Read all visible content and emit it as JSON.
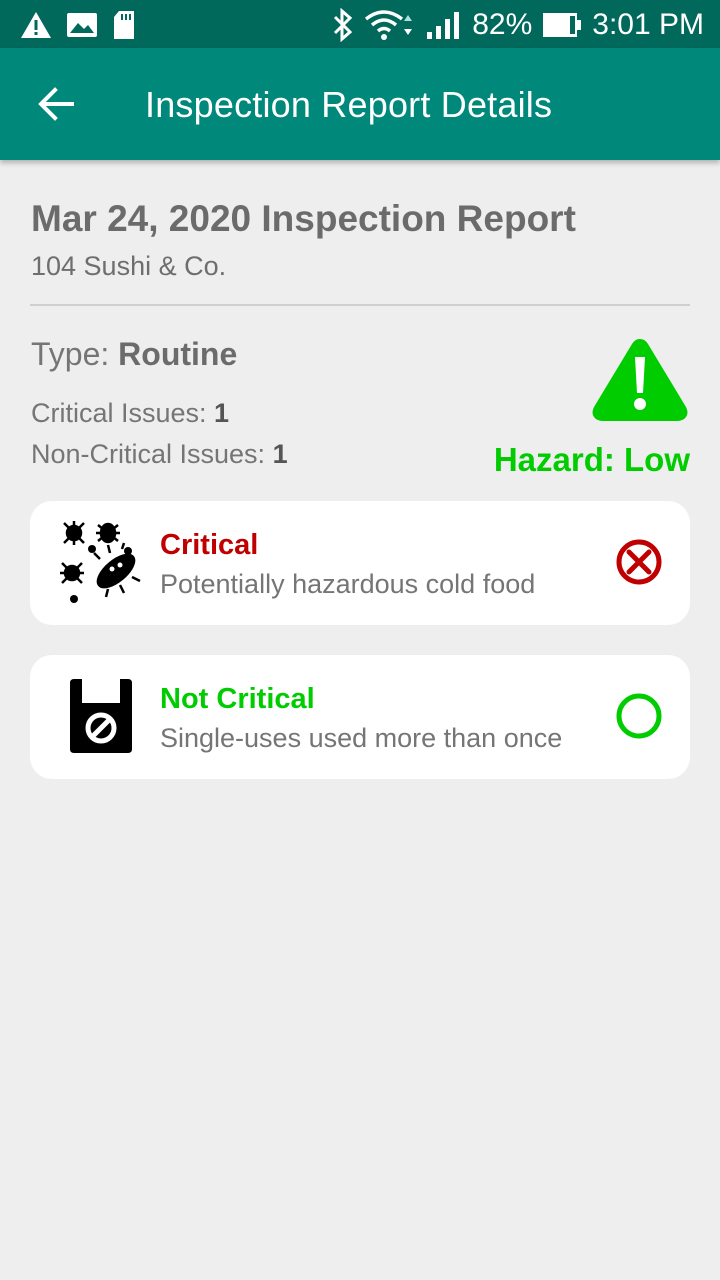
{
  "status_bar": {
    "battery": "82%",
    "time": "3:01 PM",
    "icons": [
      "alert-icon",
      "image-icon",
      "sd-card-icon",
      "bluetooth-icon",
      "wifi-icon",
      "cell-signal-icon",
      "battery-icon"
    ]
  },
  "app_bar": {
    "title": "Inspection Report Details",
    "back_icon": "arrow-back-icon"
  },
  "report": {
    "title": "Mar 24, 2020 Inspection Report",
    "restaurant": "104 Sushi & Co.",
    "type_label": "Type: ",
    "type_value": "Routine",
    "critical_label": "Critical Issues: ",
    "critical_count": "1",
    "noncritical_label": "Non-Critical Issues: ",
    "noncritical_count": "1",
    "hazard_label": "Hazard: Low",
    "hazard_color": "#00cc00"
  },
  "violations": [
    {
      "severity": "Critical",
      "description": "Potentially hazardous cold food",
      "severity_color": "#c00000",
      "icon": "germs-icon",
      "status_icon": "x-circle-icon"
    },
    {
      "severity": "Not Critical",
      "description": "Single-uses used more than once",
      "severity_color": "#00cc00",
      "icon": "no-reuse-bag-icon",
      "status_icon": "circle-icon"
    }
  ]
}
